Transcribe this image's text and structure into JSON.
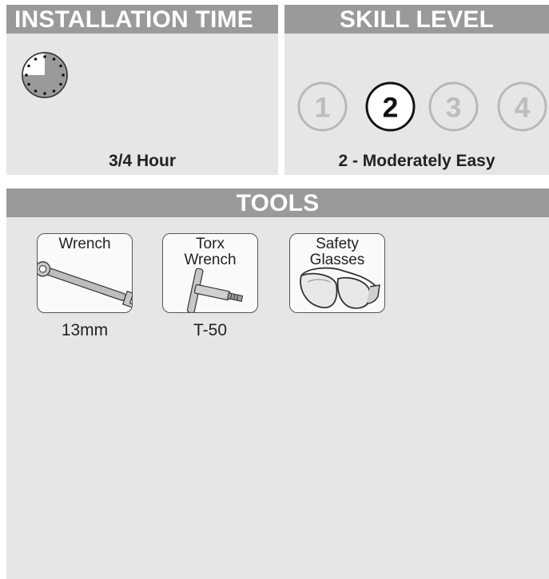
{
  "installation": {
    "header": "INSTALLATION TIME",
    "value": "3/4 Hour",
    "clock_fraction": 0.75
  },
  "skill": {
    "header": "SKILL LEVEL",
    "levels": [
      "1",
      "2",
      "3",
      "4"
    ],
    "selected": 2,
    "caption": "2 - Moderately Easy"
  },
  "tools": {
    "header": "TOOLS",
    "items": [
      {
        "name": "Wrench",
        "spec": "13mm",
        "icon": "combination-wrench-icon"
      },
      {
        "name": "Torx\nWrench",
        "spec": "T-50",
        "icon": "torx-t-handle-icon"
      },
      {
        "name": "Safety\nGlasses",
        "spec": "",
        "icon": "safety-glasses-icon"
      }
    ]
  }
}
